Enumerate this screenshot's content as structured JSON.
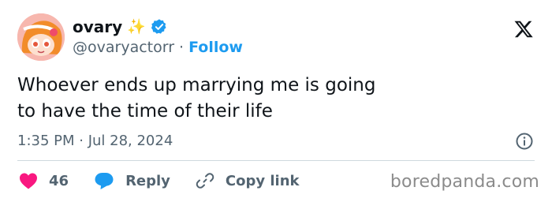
{
  "author": {
    "display_name": "ovary",
    "name_emoji": "✨",
    "handle": "@ovaryactorr",
    "separator": "·",
    "follow_label": "Follow"
  },
  "tweet": {
    "text": "Whoever ends up marrying me is going\nto have the time of their life",
    "timestamp": "1:35 PM · Jul 28, 2024"
  },
  "actions": {
    "like_count": "46",
    "reply_label": "Reply",
    "copy_link_label": "Copy link"
  },
  "watermark": "boredpanda.com",
  "colors": {
    "accent": "#1d9bf0",
    "like": "#f91880",
    "text": "#0f1419",
    "muted": "#536471"
  }
}
